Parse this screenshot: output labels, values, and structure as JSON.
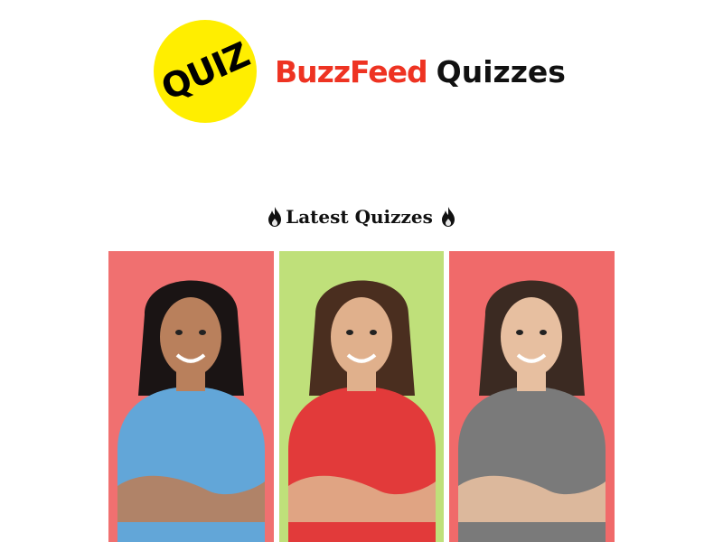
{
  "header": {
    "badge_text": "QUIZ",
    "brand_name": "BuzzFeed",
    "brand_suffix": "Quizzes",
    "brand_color": "#ee3322",
    "badge_color": "#ffee00"
  },
  "latest": {
    "title": "Latest Quizzes",
    "icon": "fire-icon"
  },
  "quizzes": [
    {
      "name": "quiz-card-1",
      "bg": "#f07070",
      "top": "#62a6d8",
      "hair": "#1a1414",
      "skin": "#b9805c"
    },
    {
      "name": "quiz-card-2",
      "bg": "#bfe07a",
      "top": "#e23a3a",
      "hair": "#4a2e1f",
      "skin": "#e0b08c"
    },
    {
      "name": "quiz-card-3",
      "bg": "#f06a6a",
      "top": "#7a7a7a",
      "hair": "#3b2a22",
      "skin": "#e7bfa0"
    }
  ]
}
